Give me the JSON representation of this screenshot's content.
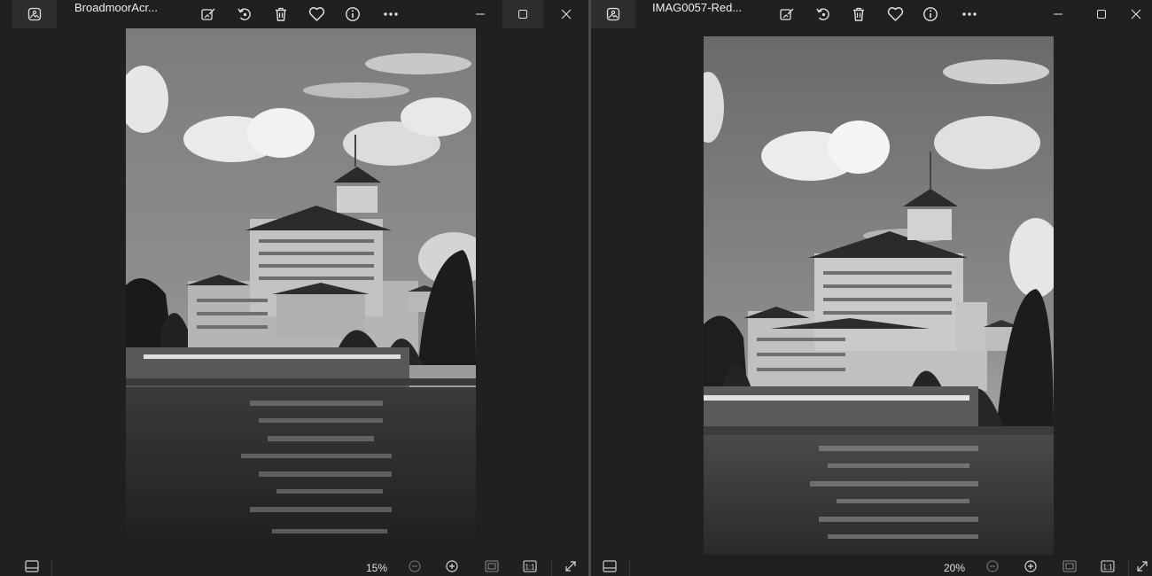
{
  "windows": [
    {
      "id": "left",
      "title": "BroadmoorAcr...",
      "zoom": "15%",
      "toolbar": [
        "edit-image-icon",
        "rotate-icon",
        "delete-icon",
        "favorite-icon",
        "info-icon",
        "more-icon"
      ],
      "window_controls": [
        "minimize",
        "maximize",
        "close"
      ],
      "status_items": [
        "filmstrip-icon",
        "zoom-out-icon",
        "zoom-in-icon",
        "fit-to-window-icon",
        "actual-size-icon",
        "full-screen-icon"
      ]
    },
    {
      "id": "right",
      "title": "IMAG0057-Red...",
      "zoom": "20%",
      "toolbar": [
        "edit-image-icon",
        "rotate-icon",
        "delete-icon",
        "favorite-icon",
        "info-icon",
        "more-icon"
      ],
      "window_controls": [
        "minimize",
        "maximize",
        "close"
      ],
      "status_items": [
        "filmstrip-icon",
        "zoom-out-icon",
        "zoom-in-icon",
        "fit-to-window-icon",
        "actual-size-icon",
        "full-screen-icon"
      ]
    }
  ],
  "colors": {
    "background": "#202020",
    "titlebar_highlight": "#2d2d2d",
    "divider": "#4a4a4a",
    "icon": "#e0e0e0"
  }
}
